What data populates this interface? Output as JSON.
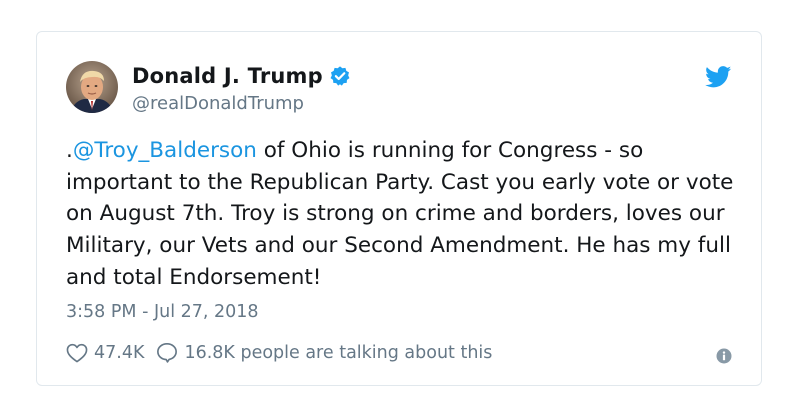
{
  "author": {
    "display_name": "Donald J. Trump",
    "handle": "@realDonaldTrump",
    "verified": true
  },
  "tweet": {
    "prefix": ".",
    "mention": "@Troy_Balderson",
    "text": " of Ohio is running for Congress - so important to the Republican Party. Cast you early vote or vote on August 7th. Troy is strong on crime and borders, loves our Military, our Vets and our Second Amendment. He has my full and total Endorsement!",
    "timestamp": "3:58 PM - Jul 27, 2018"
  },
  "stats": {
    "likes": "47.4K",
    "conversation": "16.8K people are talking about this"
  },
  "icons": {
    "brand": "twitter-bird-icon",
    "verified": "verified-badge-icon",
    "like": "heart-icon",
    "reply": "speech-bubble-icon",
    "info": "info-icon"
  },
  "colors": {
    "brand_blue": "#1da1f2",
    "link_blue": "#1b95e0",
    "secondary_text": "#657786",
    "border": "#e1e8ed"
  }
}
